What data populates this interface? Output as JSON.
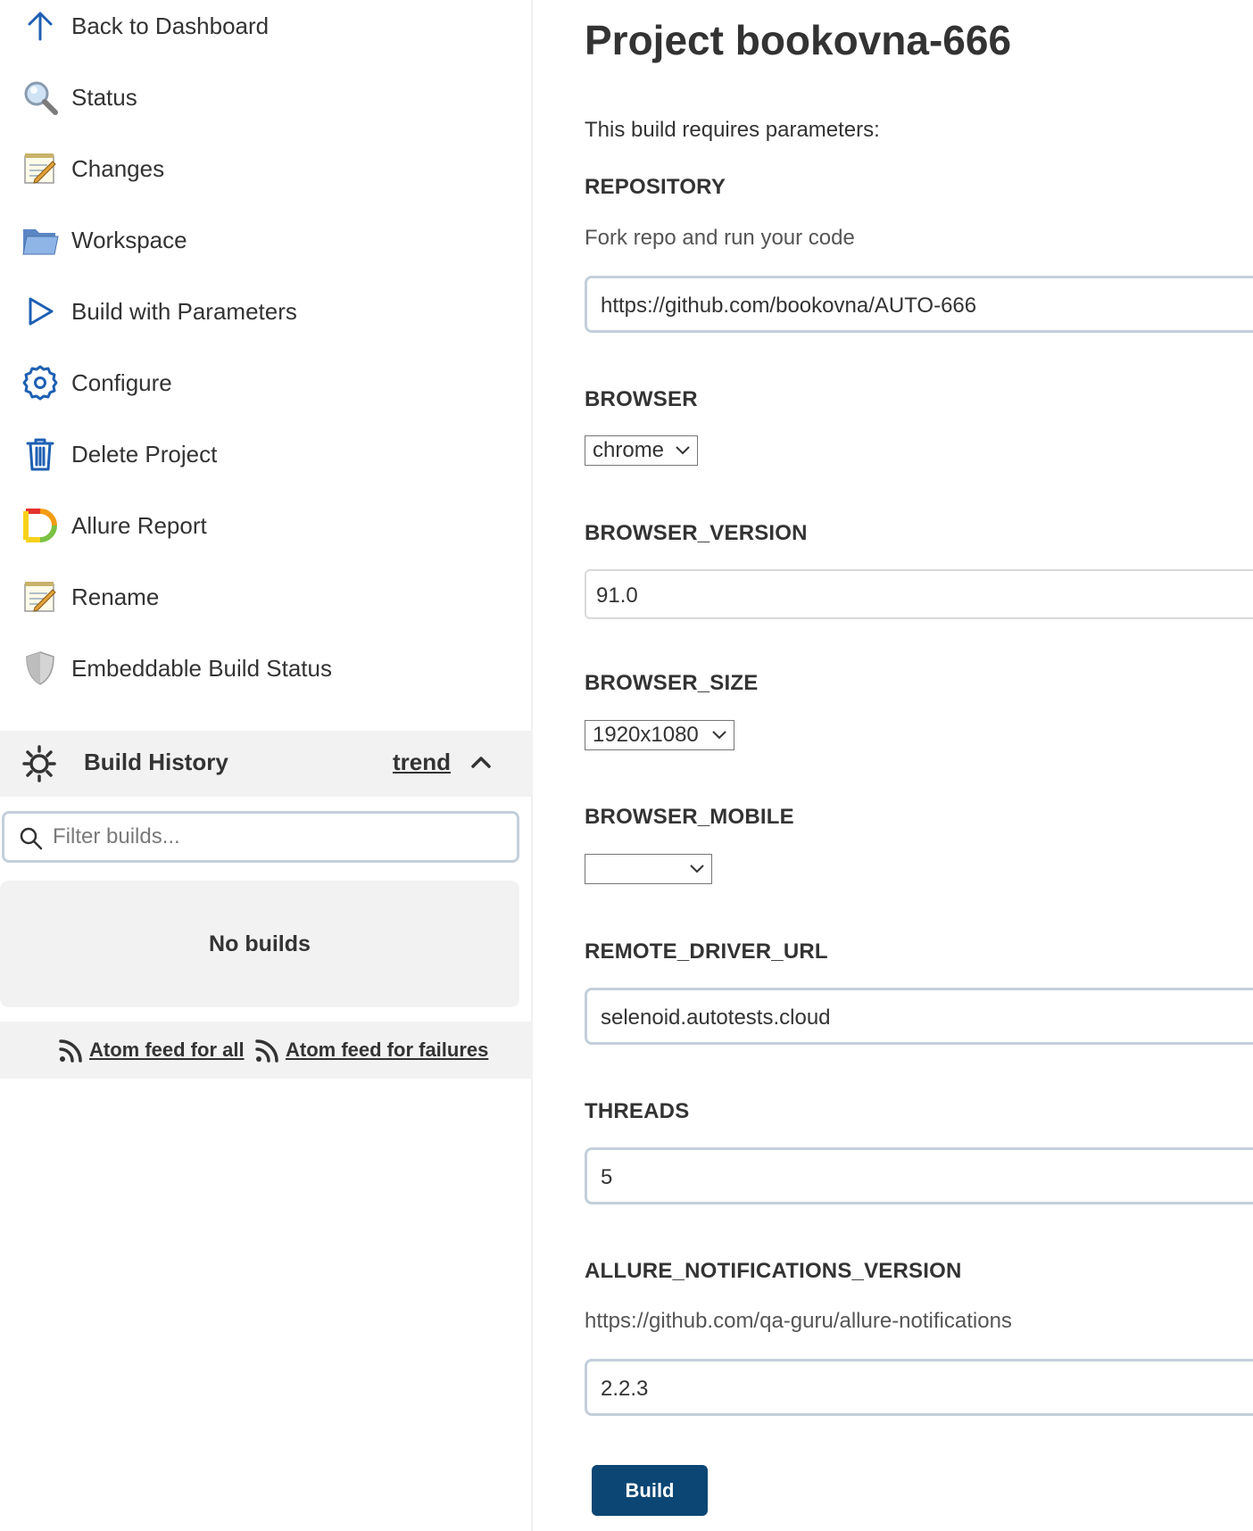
{
  "sidebar": {
    "items": [
      {
        "label": "Back to Dashboard",
        "icon": "arrow-up-icon"
      },
      {
        "label": "Status",
        "icon": "magnifier-icon"
      },
      {
        "label": "Changes",
        "icon": "notepad-icon"
      },
      {
        "label": "Workspace",
        "icon": "folder-icon"
      },
      {
        "label": "Build with Parameters",
        "icon": "play-icon"
      },
      {
        "label": "Configure",
        "icon": "gear-icon"
      },
      {
        "label": "Delete Project",
        "icon": "trash-icon"
      },
      {
        "label": "Allure Report",
        "icon": "allure-logo-icon"
      },
      {
        "label": "Rename",
        "icon": "notepad-icon"
      },
      {
        "label": "Embeddable Build Status",
        "icon": "shield-icon"
      }
    ]
  },
  "build_history": {
    "title": "Build History",
    "trend_label": "trend",
    "filter_placeholder": "Filter builds...",
    "empty_text": "No builds",
    "feed_all": "Atom feed for all",
    "feed_failures": "Atom feed for failures"
  },
  "main": {
    "title": "Project bookovna-666",
    "intro": "This build requires parameters:",
    "params": {
      "repository": {
        "name": "REPOSITORY",
        "description": "Fork repo and run your code",
        "value": "https://github.com/bookovna/AUTO-666"
      },
      "browser": {
        "name": "BROWSER",
        "value": "chrome"
      },
      "browser_version": {
        "name": "BROWSER_VERSION",
        "value": "91.0"
      },
      "browser_size": {
        "name": "BROWSER_SIZE",
        "value": "1920x1080"
      },
      "browser_mobile": {
        "name": "BROWSER_MOBILE",
        "value": ""
      },
      "remote_driver_url": {
        "name": "REMOTE_DRIVER_URL",
        "value": "selenoid.autotests.cloud"
      },
      "threads": {
        "name": "THREADS",
        "value": "5"
      },
      "allure_notifications_version": {
        "name": "ALLURE_NOTIFICATIONS_VERSION",
        "description": "https://github.com/qa-guru/allure-notifications",
        "value": "2.2.3"
      }
    },
    "build_button": "Build"
  },
  "colors": {
    "accent": "#0b4674",
    "icon_blue": "#1d5fb3",
    "panel_bg": "#f2f2f2",
    "input_border": "#c4cfdb"
  }
}
